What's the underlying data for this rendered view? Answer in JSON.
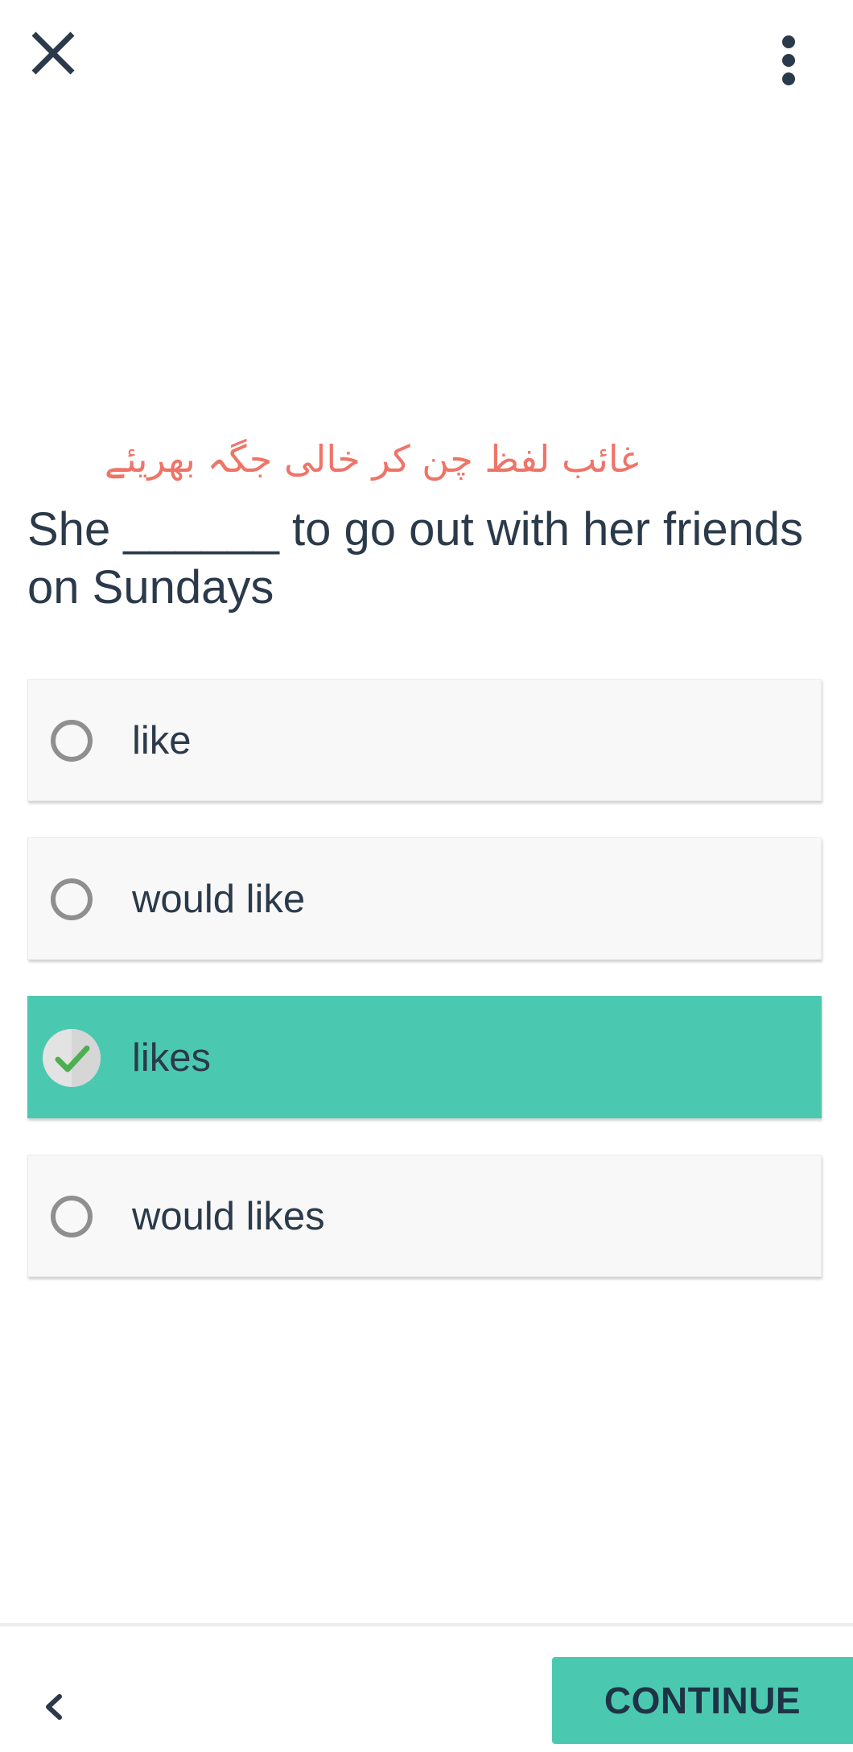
{
  "header": {
    "close_icon": "close-icon",
    "menu_icon": "more-vertical-icon"
  },
  "exercise": {
    "instruction": "غائب لفظ چن کر خالی جگہ بھریئے",
    "instruction_color": "#ef7468",
    "question": "She ______ to go out with her friends on Sundays"
  },
  "options": [
    {
      "label": "like",
      "selected": false
    },
    {
      "label": "would like",
      "selected": false
    },
    {
      "label": "likes",
      "selected": true
    },
    {
      "label": "would likes",
      "selected": false
    }
  ],
  "footer": {
    "back_icon": "chevron-left-icon",
    "continue_label": "CONTINUE"
  },
  "colors": {
    "accent": "#4bc9b0",
    "text": "#2b3a4a",
    "check": "#4caf50"
  }
}
